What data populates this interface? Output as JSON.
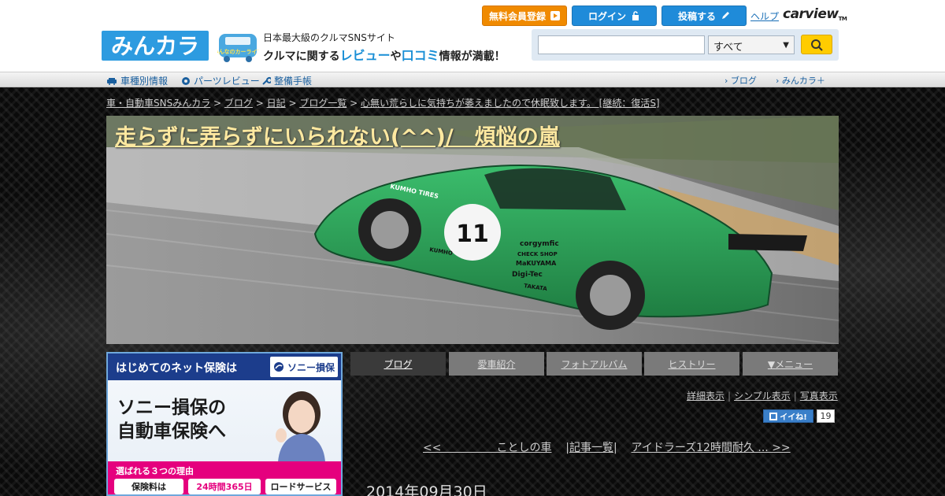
{
  "header": {
    "logo_text": "みんカラ",
    "mascot_text": "みんなのカーライフ",
    "tagline1": "日本最大級のクルマSNSサイト",
    "tagline2_a": "クルマに関する",
    "tagline2_review": "レビュー",
    "tagline2_ya": "や",
    "tagline2_kuchikomi": "口コミ",
    "tagline2_b": "情報が満載！",
    "btn_register": "無料会員登録",
    "btn_login": "ログイン",
    "btn_post": "投稿する",
    "help": "ヘルプ",
    "carview": "carview",
    "search": {
      "placeholder": "",
      "select_value": "すべて"
    }
  },
  "nav": {
    "items": [
      "車種別情報",
      "パーツレビュー",
      "整備手帳"
    ],
    "right": [
      "ブログ",
      "みんカラ＋"
    ]
  },
  "breadcrumb": {
    "items": [
      "車・自動車SNSみんカラ",
      "ブログ",
      "日記",
      "ブログ一覧",
      "心無い荒らしに気持ちが萎えましたので休眠致します。 [継続：復活S]"
    ]
  },
  "blog": {
    "title": "走らずに弄らずにいられない(^^)/　煩悩の嵐",
    "tabs": [
      "ブログ",
      "愛車紹介",
      "フォトアルバム",
      "ヒストリー",
      "▼メニュー"
    ],
    "view_links": [
      "詳細表示",
      "シンプル表示",
      "写真表示"
    ],
    "iine_label": "イイね!",
    "iine_count": "19",
    "prev": "<<　　　　　ことしの車",
    "list": "記事一覧",
    "next": "アイドラーズ12時間耐久 ... >>",
    "date": "2014年09月30日"
  },
  "hero_car": {
    "number": "11",
    "sponsors": [
      "KUMHO TIRES",
      "corgymfic",
      "CHECK SHOP",
      "MaKUYAMA",
      "Digi-Tec",
      "TAKATA",
      "KUMHO"
    ]
  },
  "ad": {
    "top_text": "はじめてのネット保険は",
    "brand": "ソニー損保",
    "headline1": "ソニー損保の",
    "headline2": "自動車保険へ",
    "reason": "選ばれる３つの理由",
    "chips": [
      "保険料は",
      "24時間365日",
      "ロードサービス"
    ]
  },
  "colors": {
    "accent_blue": "#1f8bd9",
    "accent_orange": "#f08a00",
    "car_green": "#2ea35a"
  }
}
